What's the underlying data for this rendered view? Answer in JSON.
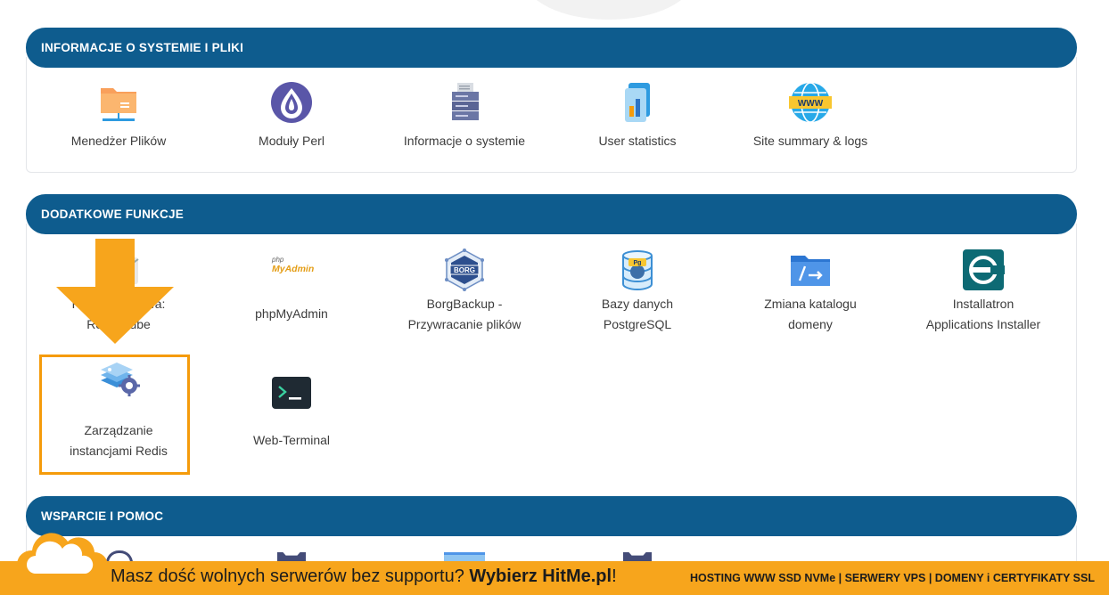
{
  "sections": [
    {
      "title": "INFORMACJE O SYSTEMIE I PLIKI",
      "items": [
        {
          "label1": "Menedżer Plików",
          "label2": ""
        },
        {
          "label1": "Moduły Perl",
          "label2": ""
        },
        {
          "label1": "Informacje o systemie",
          "label2": ""
        },
        {
          "label1": "User statistics",
          "label2": ""
        },
        {
          "label1": "Site summary & logs",
          "label2": ""
        }
      ]
    },
    {
      "title": "DODATKOWE FUNKCJE",
      "items": [
        {
          "label1": "Poczta Webowa:",
          "label2": "Roundcube"
        },
        {
          "label1": "phpMyAdmin",
          "label2": ""
        },
        {
          "label1": "BorgBackup -",
          "label2": "Przywracanie plików"
        },
        {
          "label1": "Bazy danych",
          "label2": "PostgreSQL"
        },
        {
          "label1": "Zmiana katalogu",
          "label2": "domeny"
        },
        {
          "label1": "Installatron",
          "label2": "Applications Installer"
        },
        {
          "label1": "Zarządzanie",
          "label2": "instancjami Redis"
        },
        {
          "label1": "Web-Terminal",
          "label2": ""
        }
      ]
    },
    {
      "title": "WSPARCIE I POMOC",
      "items": []
    }
  ],
  "icons": {
    "borg_text": "BORG",
    "pg_text": "Pg",
    "www_text": "WWW",
    "php_small": "php",
    "php_main": "MyAdmin"
  },
  "banner": {
    "text_prefix": "Masz dość wolnych serwerów bez supportu?",
    "text_bold": "Wybierz HitMe.pl",
    "text_suffix": "!",
    "right": "HOSTING WWW SSD NVMe | SERWERY VPS | DOMENY i CERTYFIKATY SSL"
  },
  "colors": {
    "header": "#0e5c8e",
    "highlight": "#f59b0b",
    "banner": "#f7a51c"
  }
}
